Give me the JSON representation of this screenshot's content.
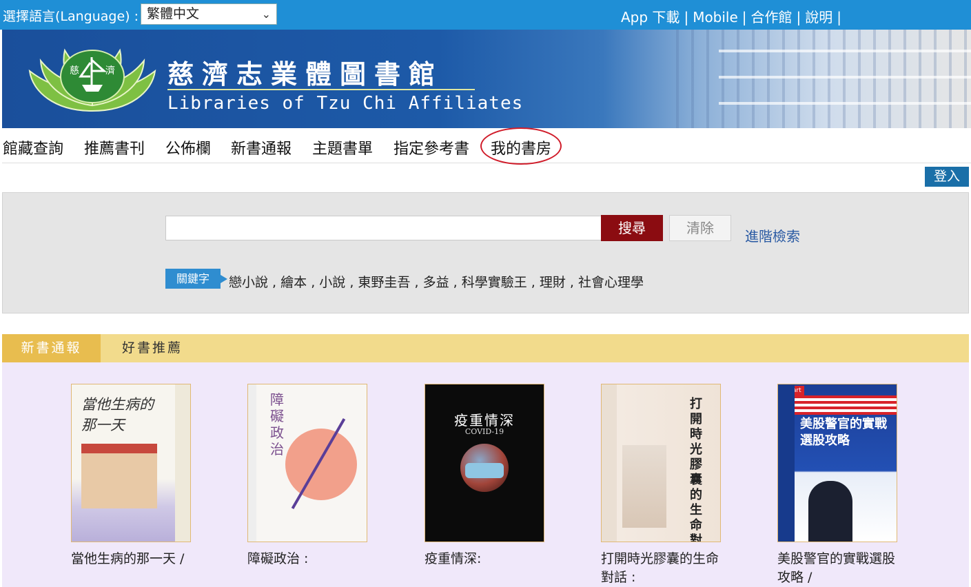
{
  "topbar": {
    "language_label": "選擇語言(Language) :",
    "language_selected": "繁體中文",
    "links": [
      "App 下載",
      "Mobile",
      "合作館",
      "說明"
    ]
  },
  "banner": {
    "title_zh": "慈濟志業體圖書館",
    "title_en": "Libraries of Tzu Chi Affiliates",
    "logo_text_left": "慈",
    "logo_text_right": "濟"
  },
  "nav": {
    "items": [
      "館藏查詢",
      "推薦書刊",
      "公佈欄",
      "新書通報",
      "主題書單",
      "指定參考書",
      "我的書房"
    ]
  },
  "login_label": "登入",
  "search": {
    "query": "",
    "search_label": "搜尋",
    "clear_label": "清除",
    "advanced_label": "進階檢索",
    "keyword_badge": "關鍵字",
    "keywords": [
      "戀小說",
      "繪本",
      "小說",
      "東野圭吾",
      "多益",
      "科學實驗王",
      "理財",
      "社會心理學"
    ]
  },
  "tabs": {
    "active": "新書通報",
    "inactive": "好書推薦"
  },
  "books": [
    {
      "title": "當他生病的那一天 /",
      "cover_text": "當他生病的那一天"
    },
    {
      "title": "障礙政治 :",
      "cover_text": "障礙政治"
    },
    {
      "title": "疫重情深:",
      "cover_text": "疫重情深",
      "cover_sub": "COVID-19"
    },
    {
      "title": "打開時光膠囊的生命對話 :",
      "cover_text": "打開時光膠囊的生命對話"
    },
    {
      "title": "美股警官的實戰選股攻略 /",
      "cover_text": "美股警官的實戰選股攻略",
      "cover_badge": "Smart"
    }
  ],
  "colors": {
    "topbar": "#1f8fd6",
    "search_button": "#8b0c11",
    "tab_active": "#e8bd4f",
    "tab_bar": "#f2db8c",
    "book_area": "#f0e8fa",
    "login": "#1a6fa8",
    "highlight_ring": "#d01c2a"
  },
  "icons": {
    "language_dropdown": "chevron-down-icon",
    "logo": "tzu-chi-lotus-logo"
  }
}
